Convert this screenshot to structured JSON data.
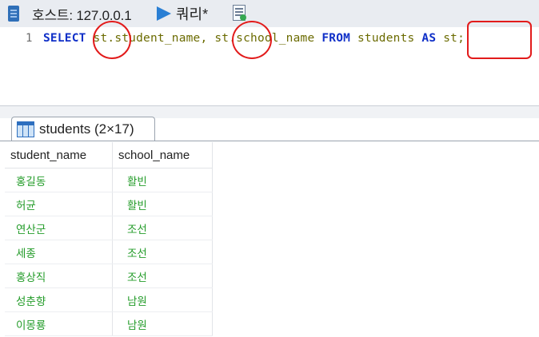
{
  "tabs": {
    "host_label": "호스트: 127.0.0.1",
    "query_label": "쿼리*"
  },
  "editor": {
    "line_number": "1",
    "tokens": {
      "select": "SELECT",
      "col1": "st.student_name,",
      "col2": "st.school_name",
      "from": "FROM",
      "table": "students",
      "as": "AS",
      "alias": "st;"
    }
  },
  "result": {
    "tab_label": "students (2×17)",
    "columns": [
      "student_name",
      "school_name"
    ],
    "rows": [
      [
        "홍길동",
        "활빈"
      ],
      [
        "허균",
        "활빈"
      ],
      [
        "연산군",
        "조선"
      ],
      [
        "세종",
        "조선"
      ],
      [
        "홍상직",
        "조선"
      ],
      [
        "성춘향",
        "남원"
      ],
      [
        "이몽룡",
        "남원"
      ]
    ]
  },
  "colors": {
    "keyword": "#1030c8",
    "identifier": "#6b6b00",
    "cell_text": "#249c2a",
    "highlight": "#e21b1b"
  }
}
